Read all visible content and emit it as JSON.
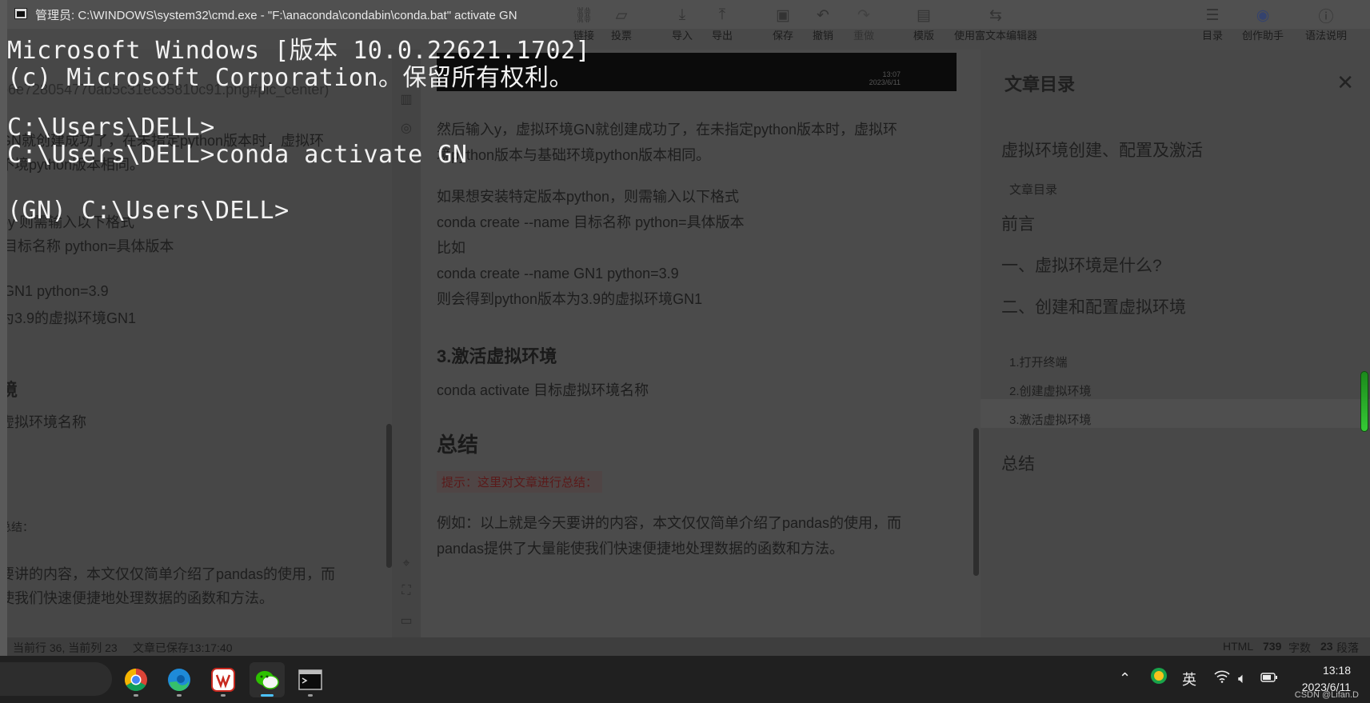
{
  "editor": {
    "toolbar": [
      {
        "label": "导入",
        "icon": "import-icon"
      },
      {
        "label": "导出",
        "icon": "export-icon"
      },
      {
        "label": "保存",
        "icon": "save-icon"
      },
      {
        "label": "撤销",
        "icon": "undo-icon"
      },
      {
        "label": "重做",
        "icon": "redo-icon"
      },
      {
        "label": "模版",
        "icon": "template-icon"
      },
      {
        "label": "使用富文本编辑器",
        "icon": "rich-text-icon"
      },
      {
        "label": "目录",
        "icon": "toc-icon"
      },
      {
        "label": "创作助手",
        "icon": "robot-icon"
      },
      {
        "label": "语法说明",
        "icon": "help-icon"
      },
      {
        "label": "链接",
        "icon": "link-icon"
      },
      {
        "label": "投票",
        "icon": "vote-icon"
      }
    ],
    "left_pane_lines": [
      "b6e728054770ab5c31ec35810c91.png#pic_center)",
      "GN就创建成功了，在未指定python版本时，虚拟环",
      "不境python版本相同。",
      "py 则需输入以下格式",
      "目标名称 python=具体版本",
      "GN1 python=3.9",
      "为3.9的虚拟环境GN1",
      "境",
      "虚拟环境名称",
      "总结：",
      "要讲的内容，本文仅仅简单介绍了pandas的使用，而",
      "使我们快速便捷地处理数据的函数和方法。"
    ],
    "article": {
      "p1_a": "然后输入y，虚拟环境GN就创建成功了，在未指定python版本时，虚拟环",
      "p1_b": "境python版本与基础环境python版本相同。",
      "p2_a": "如果想安装特定版本python，则需输入以下格式",
      "p2_b": "conda create --name 目标名称 python=具体版本",
      "p2_c": "比如",
      "p2_d": "conda create --name GN1 python=3.9",
      "p2_e": "则会得到python版本为3.9的虚拟环境GN1",
      "h_activate": "3.激活虚拟环境",
      "activate_cmd": "conda activate 目标虚拟环境名称",
      "h_summary": "总结",
      "tip": "提示：这里对文章进行总结：",
      "p3_a": "例如：以上就是今天要讲的内容，本文仅仅简单介绍了pandas的使用，而",
      "p3_b": "pandas提供了大量能使我们快速便捷地处理数据的函数和方法。",
      "img_time": "13:07",
      "img_date": "2023/6/11"
    },
    "toc": {
      "title": "文章目录",
      "items": [
        {
          "text": "虚拟环境创建、配置及激活",
          "level": 1
        },
        {
          "text": "文章目录",
          "level": 2
        },
        {
          "text": "前言",
          "level": 1
        },
        {
          "text": "一、虚拟环境是什么?",
          "level": 1
        },
        {
          "text": "二、创建和配置虚拟环境",
          "level": 1
        },
        {
          "text": "1.打开终端",
          "level": 2
        },
        {
          "text": "2.创建虚拟环境",
          "level": 2
        },
        {
          "text": "3.激活虚拟环境",
          "level": 2
        },
        {
          "text": "总结",
          "level": 1
        }
      ]
    },
    "status": {
      "left": "当前行 36, 当前列 23",
      "saved": "文章已保存13:17:40",
      "format": "HTML",
      "chars": "739",
      "chars_label": "字数",
      "paras": "23",
      "paras_label": "段落"
    }
  },
  "cmd": {
    "title": "管理员: C:\\WINDOWS\\system32\\cmd.exe - \"F:\\anaconda\\condabin\\conda.bat\"  activate GN",
    "lines": [
      "Microsoft Windows [版本 10.0.22621.1702]",
      "(c) Microsoft Corporation。保留所有权利。",
      "C:\\Users\\DELL>",
      "C:\\Users\\DELL>conda activate GN",
      "(GN) C:\\Users\\DELL>"
    ]
  },
  "taskbar": {
    "apps": [
      "chrome-icon",
      "edge-icon",
      "wps-icon",
      "wechat-icon",
      "terminal-icon"
    ],
    "ime": "英",
    "time": "13:18",
    "date": "2023/6/11",
    "watermark": "CSDN @Lifan.D"
  }
}
